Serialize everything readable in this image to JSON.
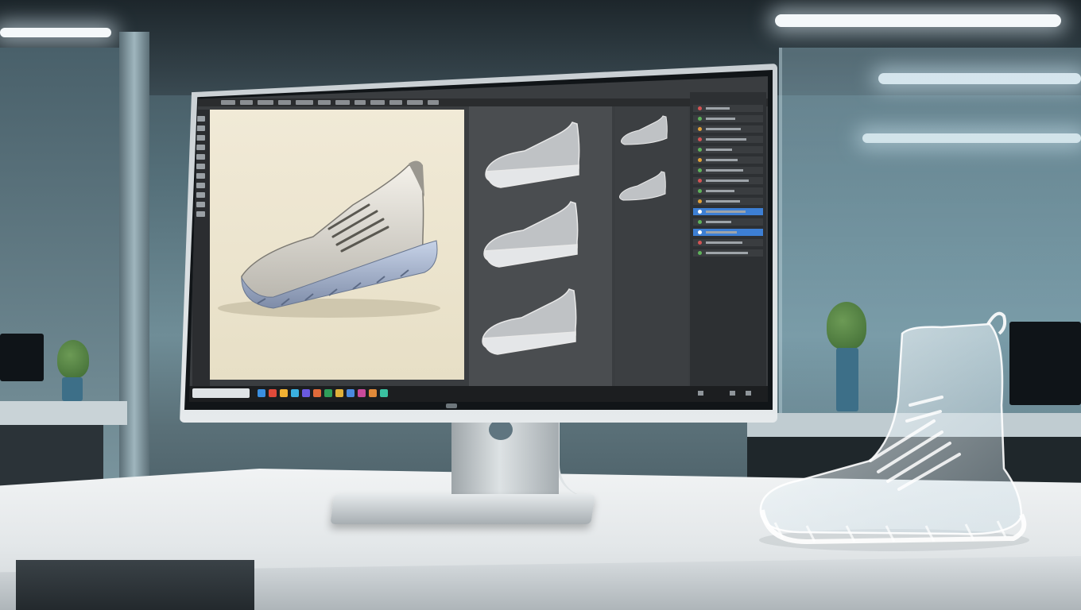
{
  "scene": {
    "description_colors": {
      "background": "#55707a",
      "desk": "#e3e7e9",
      "monitor_frame": "#d8dde0",
      "canvas": "#efe8d3",
      "panel_dark": "#3a3d40",
      "selection": "#3d7fd4"
    }
  },
  "screen": {
    "menu_items_count_hint": "menu",
    "canvas": {
      "subject": "leather-sneaker-render"
    },
    "variants": [
      {
        "name": "variant-1"
      },
      {
        "name": "variant-2"
      },
      {
        "name": "variant-3"
      }
    ],
    "thumbnails": [
      {
        "name": "thumb-1"
      },
      {
        "name": "thumb-2"
      }
    ],
    "layers": [
      {
        "color": "#d35454",
        "selected": false
      },
      {
        "color": "#5fb35b",
        "selected": false
      },
      {
        "color": "#e0a13a",
        "selected": false
      },
      {
        "color": "#d35454",
        "selected": false
      },
      {
        "color": "#5fb35b",
        "selected": false
      },
      {
        "color": "#e0a13a",
        "selected": false
      },
      {
        "color": "#5fb35b",
        "selected": false
      },
      {
        "color": "#d35454",
        "selected": false
      },
      {
        "color": "#5fb35b",
        "selected": false
      },
      {
        "color": "#e0a13a",
        "selected": false
      },
      {
        "color": "#ffffff",
        "selected": true
      },
      {
        "color": "#5fb35b",
        "selected": false
      },
      {
        "color": "#ffffff",
        "selected": true
      },
      {
        "color": "#d35454",
        "selected": false
      },
      {
        "color": "#5fb35b",
        "selected": false
      }
    ],
    "taskbar_icons": [
      "#3a8fe0",
      "#e04a3a",
      "#f2b233",
      "#3ab0e0",
      "#6a5ae0",
      "#e06a3a",
      "#2f9e5a",
      "#e0b03a",
      "#4a8ae0",
      "#c94a9a",
      "#e08a3a",
      "#3ac0a0"
    ]
  }
}
